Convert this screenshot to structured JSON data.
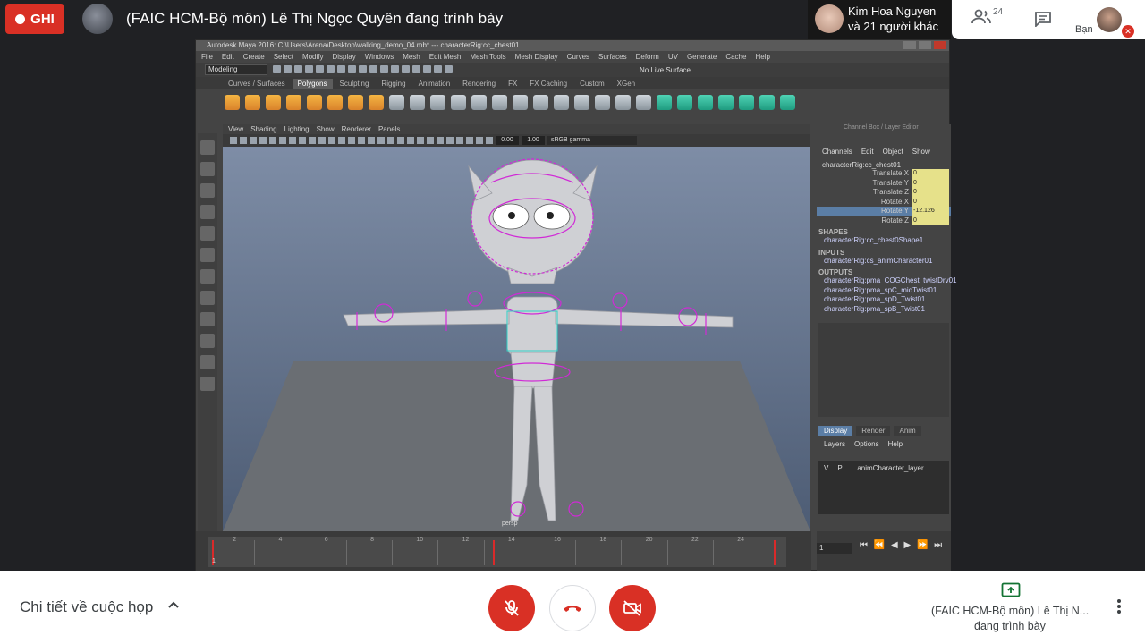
{
  "top_bar": {
    "record_label": "GHI",
    "presenter_title": "(FAIC HCM-Bộ môn) Lê Thị Ngọc Quyên đang trình bày",
    "viewer_name": "Kim Hoa Nguyen",
    "viewer_others": "và 21 người khác",
    "participants_count": "24",
    "you_label": "Bạn"
  },
  "maya": {
    "window_title": "Autodesk Maya 2016: C:\\Users\\Arena\\Desktop\\walking_demo_04.mb* --- characterRig:cc_chest01",
    "menus": [
      "File",
      "Edit",
      "Create",
      "Select",
      "Modify",
      "Display",
      "Windows",
      "Mesh",
      "Edit Mesh",
      "Mesh Tools",
      "Mesh Display",
      "Curves",
      "Surfaces",
      "Deform",
      "UV",
      "Generate",
      "Cache",
      "Help"
    ],
    "mode": "Modeling",
    "live_surface": "No Live Surface",
    "shelf_tabs": [
      "Curves / Surfaces",
      "Polygons",
      "Sculpting",
      "Rigging",
      "Animation",
      "Rendering",
      "FX",
      "FX Caching",
      "Custom",
      "XGen"
    ],
    "active_shelf": "Polygons",
    "panel_menus": [
      "View",
      "Shading",
      "Lighting",
      "Show",
      "Renderer",
      "Panels"
    ],
    "field_a": "0.00",
    "field_b": "1.00",
    "gamma": "sRGB gamma",
    "viewport_label": "persp",
    "channel_box_title": "Channel Box / Layer Editor",
    "cb_tabs": [
      "Channels",
      "Edit",
      "Object",
      "Show"
    ],
    "node_name": "characterRig:cc_chest01",
    "attributes": [
      {
        "name": "Translate X",
        "value": "0"
      },
      {
        "name": "Translate Y",
        "value": "0"
      },
      {
        "name": "Translate Z",
        "value": "0"
      },
      {
        "name": "Rotate X",
        "value": "0"
      },
      {
        "name": "Rotate Y",
        "value": "-12.126"
      },
      {
        "name": "Rotate Z",
        "value": "0"
      }
    ],
    "shapes_header": "SHAPES",
    "shapes": [
      "characterRig:cc_chest0Shape1"
    ],
    "inputs_header": "INPUTS",
    "inputs": [
      "characterRig:cs_animCharacter01"
    ],
    "outputs_header": "OUTPUTS",
    "outputs": [
      "characterRig:pma_COGChest_twistDrv01",
      "characterRig:pma_spC_midTwist01",
      "characterRig:pma_spD_Twist01",
      "characterRig:pma_spB_Twist01"
    ],
    "layer_tabs": [
      "Display",
      "Render",
      "Anim"
    ],
    "layer_menus": [
      "Layers",
      "Options",
      "Help"
    ],
    "layer_row": {
      "v": "V",
      "p": "P",
      "name": "...animCharacter_layer"
    },
    "timeline_ticks": [
      "2",
      "4",
      "6",
      "8",
      "10",
      "12",
      "14",
      "16",
      "18",
      "20",
      "22",
      "24"
    ],
    "start_frame": "1",
    "current_frame": "1"
  },
  "bottom_bar": {
    "meeting_details": "Chi tiết về cuộc họp",
    "presenter_short": "(FAIC HCM-Bộ môn) Lê Thị N...",
    "presenting": "đang trình bày"
  },
  "colors": {
    "record_red": "#d93025",
    "highlight_yellow": "#e6e18a",
    "selection_blue": "#5b7ea6",
    "rig_magenta": "#d02ad6"
  },
  "icons": [
    "record-dot-icon",
    "people-icon",
    "chat-icon",
    "mic-off-icon",
    "call-end-icon",
    "camera-off-icon",
    "present-screen-icon",
    "more-vert-icon",
    "chevron-up-icon"
  ]
}
